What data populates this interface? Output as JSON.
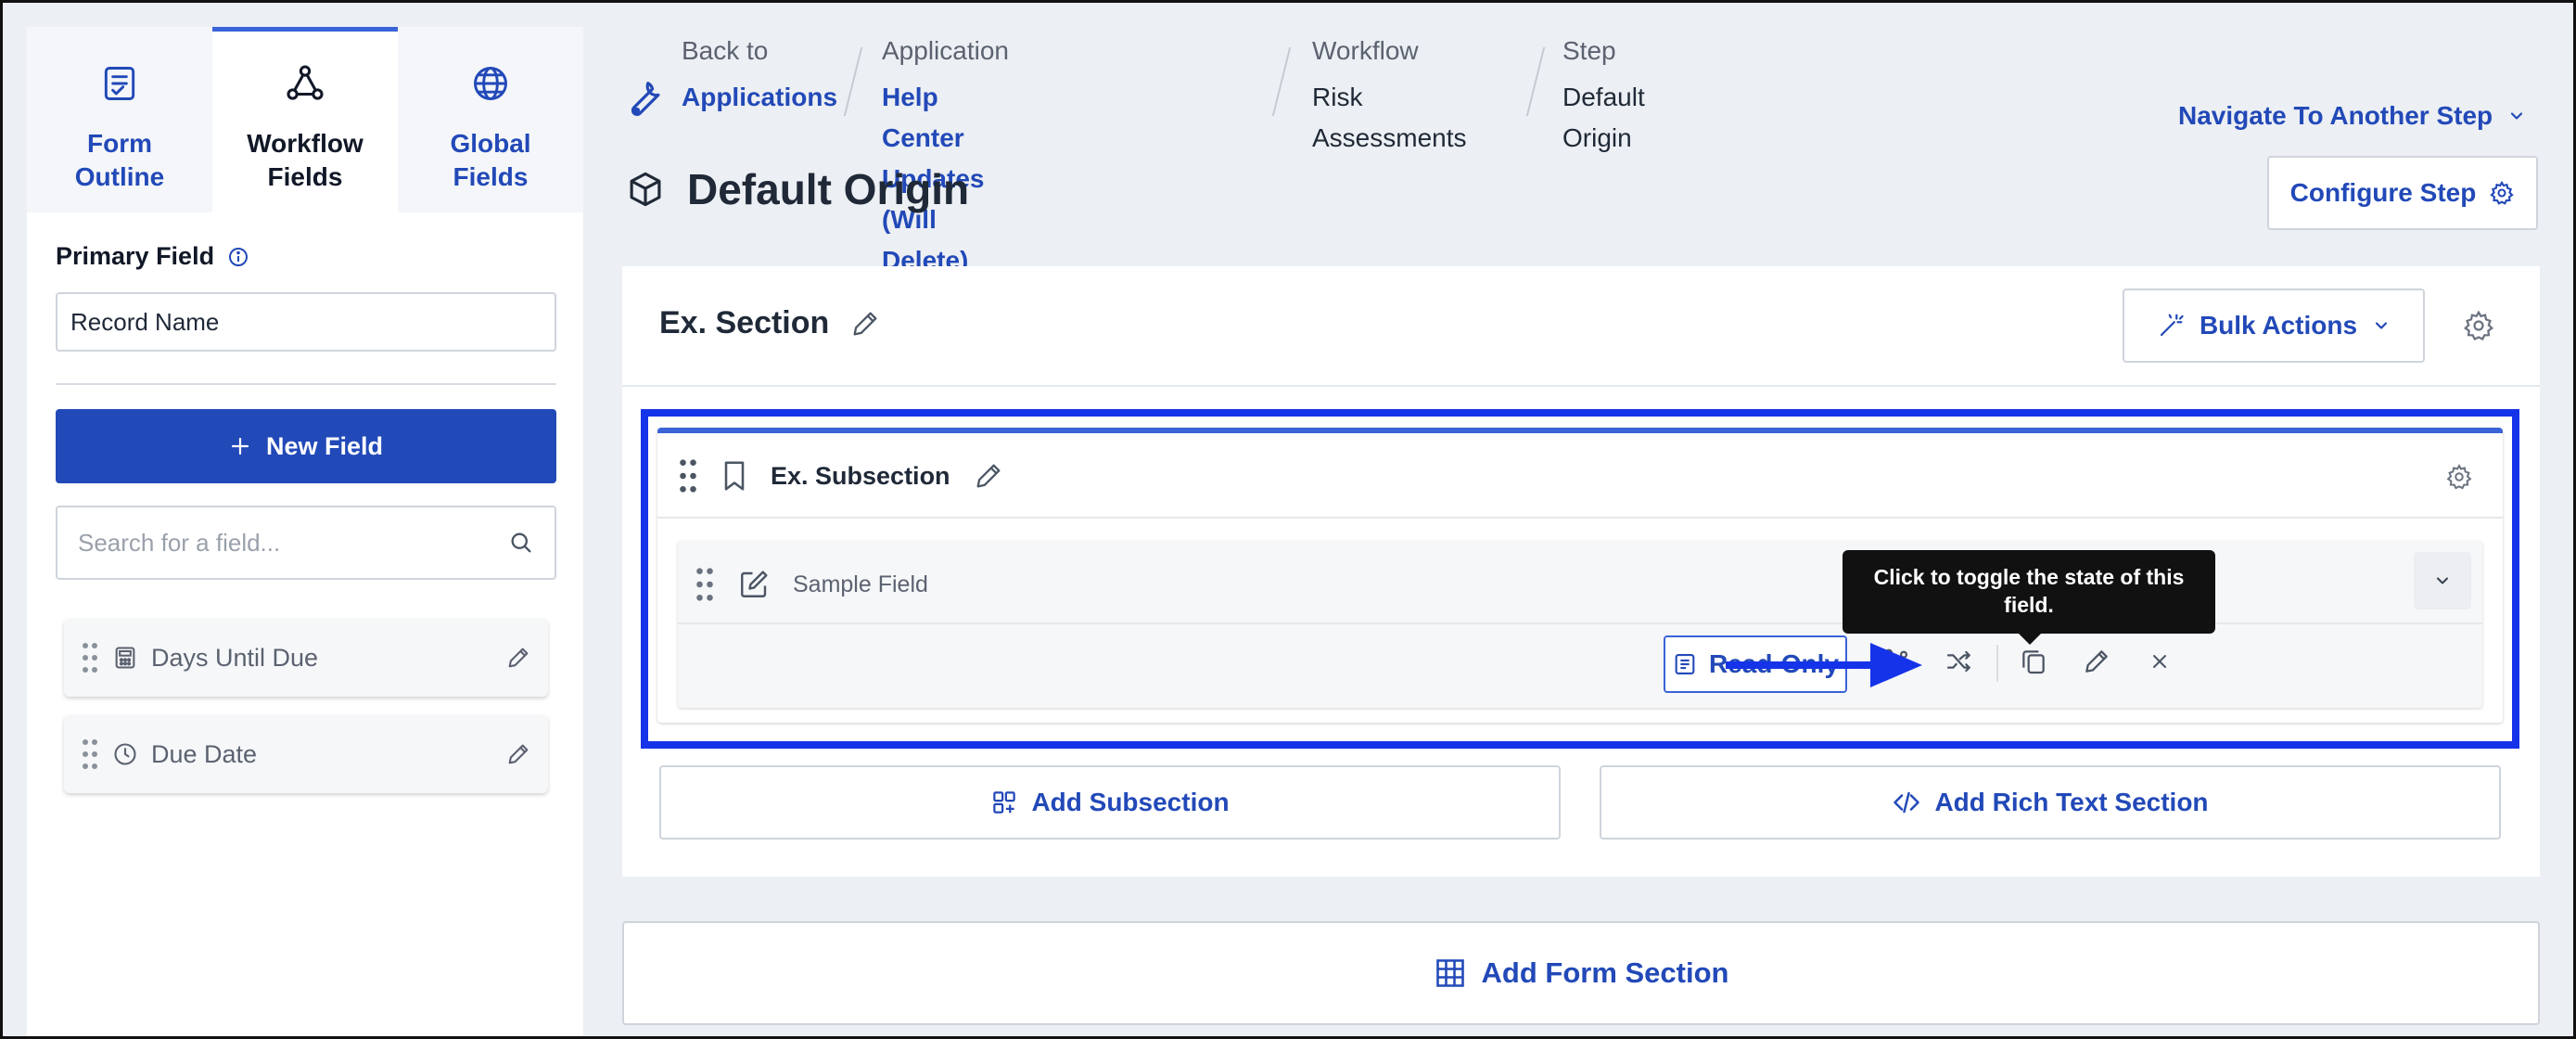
{
  "sidebar": {
    "tabs": [
      {
        "label": "Form Outline",
        "icon": "form-outline-icon"
      },
      {
        "label": "Workflow Fields",
        "icon": "workflow-icon"
      },
      {
        "label": "Global Fields",
        "icon": "globe-icon"
      }
    ],
    "primary_field_label": "Primary Field",
    "primary_field_value": "Record Name",
    "new_field_label": "New Field",
    "search_placeholder": "Search for a field...",
    "fields": [
      {
        "name": "Days Until Due",
        "icon": "calculator-icon"
      },
      {
        "name": "Due Date",
        "icon": "clock-icon"
      }
    ]
  },
  "header": {
    "breadcrumbs": [
      {
        "key": "Back to",
        "value": "Applications"
      },
      {
        "key": "Application",
        "value": "Help Center Updates (Will Delete)"
      },
      {
        "key": "Workflow",
        "value": "Risk Assessments"
      },
      {
        "key": "Step",
        "value": "Default Origin"
      }
    ],
    "navigate_label": "Navigate To Another Step",
    "configure_label": "Configure Step",
    "page_title": "Default Origin"
  },
  "section": {
    "title": "Ex. Section",
    "bulk_actions_label": "Bulk Actions",
    "subsection": {
      "title": "Ex. Subsection",
      "field": {
        "name": "Sample Field",
        "state_label": "Read-Only",
        "tooltip": "Click to toggle the state of this field."
      }
    },
    "add_subsection_label": "Add Subsection",
    "add_rich_text_label": "Add Rich Text Section"
  },
  "add_form_section_label": "Add Form Section",
  "colors": {
    "brand": "#2249b8",
    "highlight": "#1533e8",
    "tooltip_bg": "#111111"
  }
}
